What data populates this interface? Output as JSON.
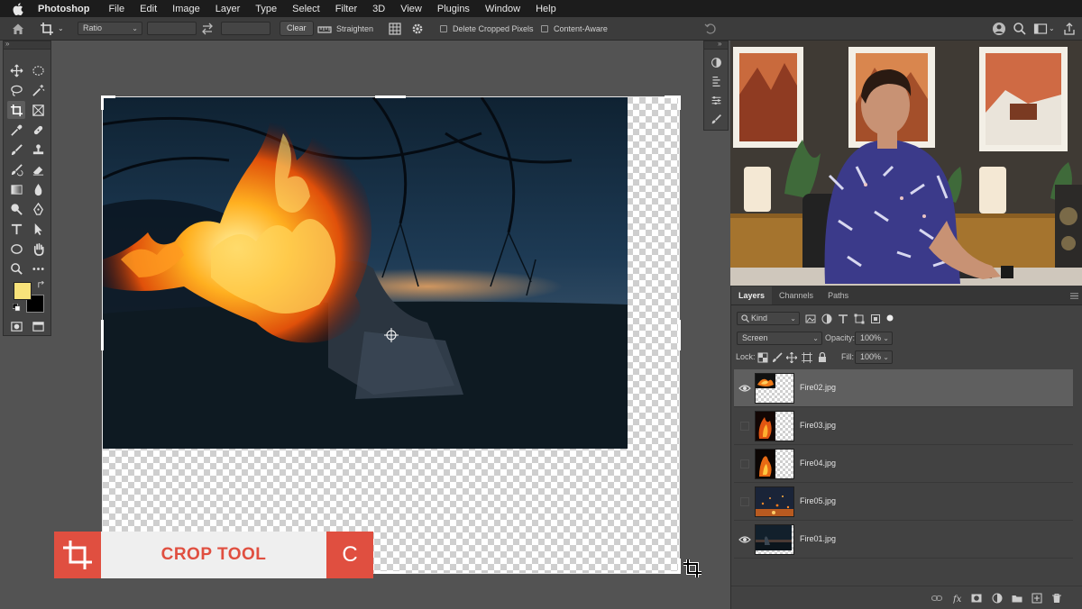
{
  "menubar": {
    "app": "Photoshop",
    "items": [
      "File",
      "Edit",
      "Image",
      "Layer",
      "Type",
      "Select",
      "Filter",
      "3D",
      "View",
      "Plugins",
      "Window",
      "Help"
    ]
  },
  "options": {
    "ratio": "Ratio",
    "clear": "Clear",
    "straighten": "Straighten",
    "delete_cropped": "Delete Cropped Pixels",
    "content_aware": "Content-Aware"
  },
  "colors": {
    "foreground": "#f8e27a",
    "background": "#000000",
    "accent": "#e04f40"
  },
  "banner": {
    "label": "CROP TOOL",
    "key": "C"
  },
  "layers_panel": {
    "tabs": [
      "Layers",
      "Channels",
      "Paths"
    ],
    "kind": "Kind",
    "blend_mode": "Screen",
    "opacity_label": "Opacity:",
    "opacity": "100%",
    "lock_label": "Lock:",
    "fill_label": "Fill:",
    "fill": "100%",
    "layers": [
      {
        "name": "Fire02.jpg",
        "visible": true,
        "selected": true
      },
      {
        "name": "Fire03.jpg",
        "visible": false,
        "selected": false
      },
      {
        "name": "Fire04.jpg",
        "visible": false,
        "selected": false
      },
      {
        "name": "Fire05.jpg",
        "visible": false,
        "selected": false
      },
      {
        "name": "Fire01.jpg",
        "visible": true,
        "selected": false
      }
    ]
  }
}
